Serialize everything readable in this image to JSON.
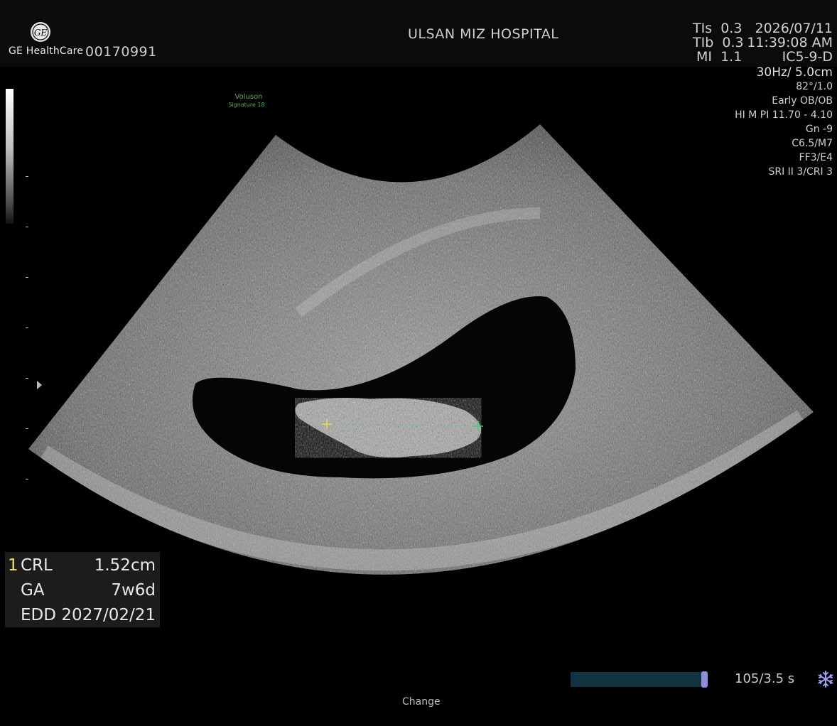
{
  "header": {
    "brand": "GE HealthCare",
    "patient_id": "00170991",
    "hospital": "ULSAN MIZ HOSPITAL",
    "date": "2026/07/11",
    "time": "11:39:08 AM",
    "probe": "IC5-9-D",
    "tis": "TIs  0.3",
    "tib": "TIb  0.3",
    "mi": "MI  1.1"
  },
  "params": {
    "frame_depth": "30Hz/ 5.0cm",
    "angle": "82°/1.0",
    "preset": "Early OB/OB",
    "himpi": "HI M PI 11.70 - 4.10",
    "gain": "Gn  -9",
    "c_m": "C6.5/M7",
    "ff_e": "FF3/E4",
    "sri_cri": "SRI II 3/CRI 3"
  },
  "system_label": {
    "line1": "Voluson",
    "line2": "Signature 18"
  },
  "measurements": {
    "index": "1",
    "rows": [
      {
        "label": "CRL",
        "value": "1.52cm"
      },
      {
        "label": "GA",
        "value": "7w6d"
      },
      {
        "label": "EDD",
        "value": "2027/02/21"
      }
    ]
  },
  "cine": {
    "counter": "105/3.5 s",
    "progress": 1.0
  },
  "bottom": {
    "change": "Change"
  },
  "icons": {
    "logo": "ge-logo-icon",
    "freeze": "snowflake-icon"
  },
  "colors": {
    "caliper_start": "#e6e04a",
    "caliper_end": "#3bd16b",
    "index": "#f3e36b",
    "cine_handle": "#8d8ddc"
  }
}
